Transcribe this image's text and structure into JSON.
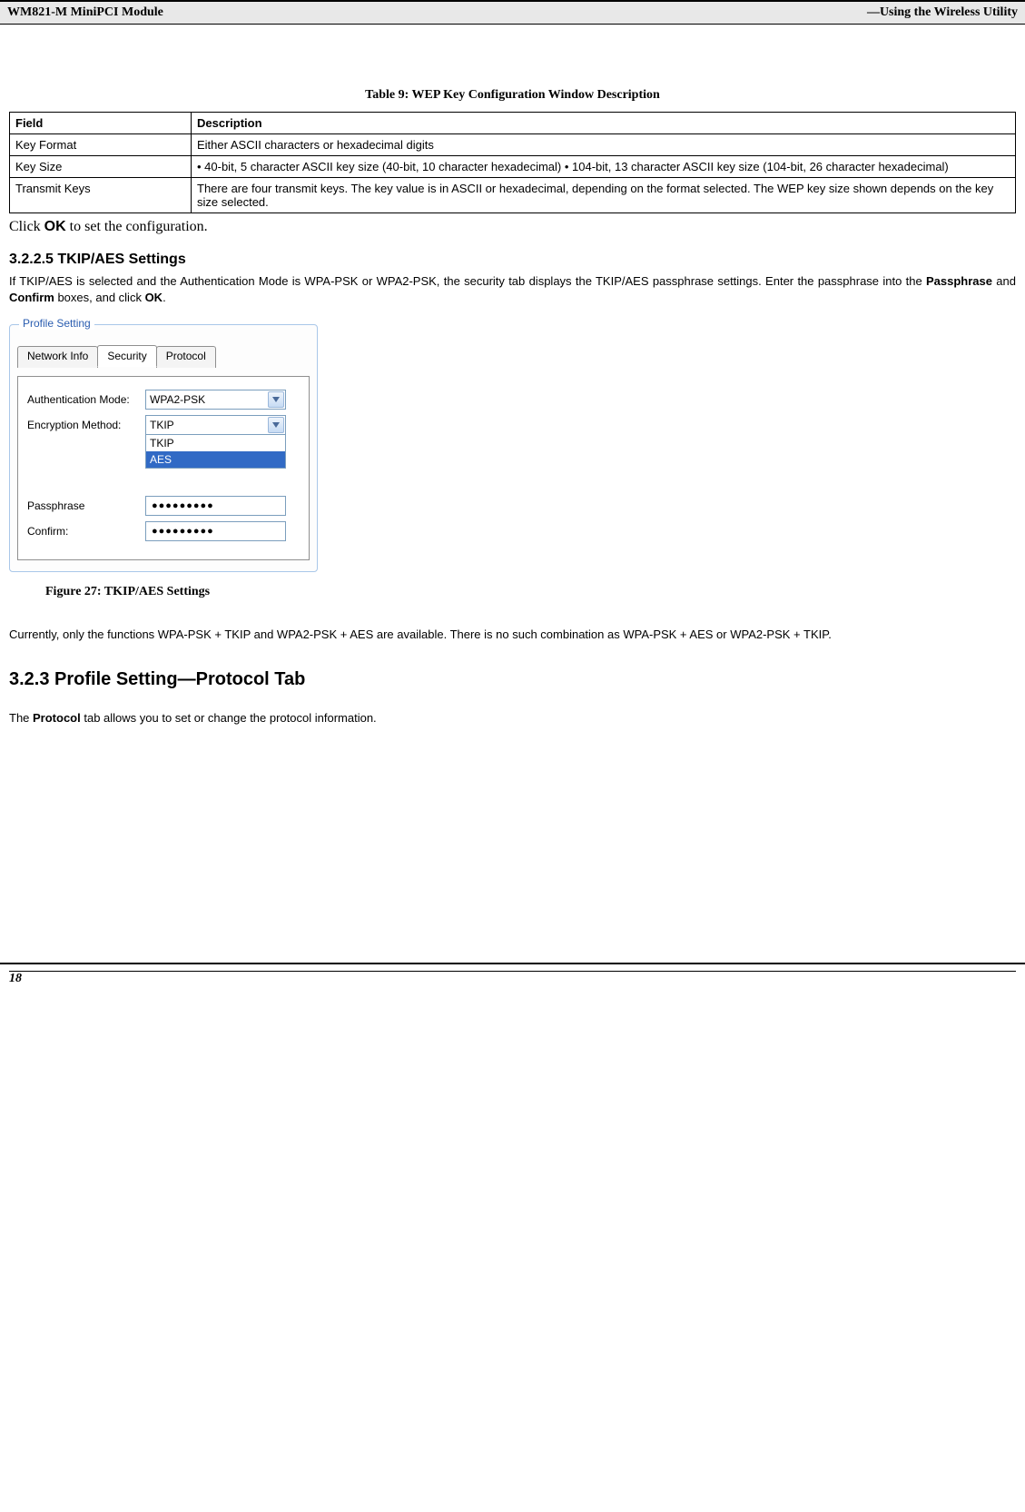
{
  "header": {
    "left": "WM821-M MiniPCI Module",
    "right": "—Using the Wireless Utility"
  },
  "table": {
    "caption": "Table 9: WEP Key Configuration Window Description",
    "headers": [
      "Field",
      "Description"
    ],
    "rows": [
      {
        "field": "Key Format",
        "desc": "Either ASCII characters or hexadecimal digits"
      },
      {
        "field": "Key Size",
        "desc": "• 40-bit, 5 character ASCII key size (40-bit, 10 character hexadecimal) • 104-bit, 13 character ASCII key size (104-bit, 26 character hexadecimal)"
      },
      {
        "field": "Transmit Keys",
        "desc": "There are four transmit keys. The key value is in ASCII or hexadecimal, depending on the format selected. The WEP key size shown depends on the key size selected."
      }
    ]
  },
  "after_table": {
    "pre": "Click ",
    "bold": "OK",
    "post": " to set the configuration."
  },
  "section_tkip": {
    "heading": "3.2.2.5 TKIP/AES Settings",
    "p1_pre": "If TKIP/AES is selected and the Authentication Mode is WPA-PSK or WPA2-PSK, the security tab displays the TKIP/AES passphrase settings. Enter the passphrase into the ",
    "p1_b1": "Passphrase",
    "p1_mid1": " and ",
    "p1_b2": "Confirm",
    "p1_mid2": " boxes, and click ",
    "p1_b3": "OK",
    "p1_end": "."
  },
  "dialog": {
    "group_title": "Profile Setting",
    "tabs": [
      "Network Info",
      "Security",
      "Protocol"
    ],
    "active_tab_index": 1,
    "auth_label": "Authentication Mode:",
    "auth_value": "WPA2-PSK",
    "enc_label": "Encryption Method:",
    "enc_value": "TKIP",
    "enc_options": [
      "TKIP",
      "AES"
    ],
    "enc_selected_index": 1,
    "pass_label": "Passphrase",
    "pass_value": "●●●●●●●●●",
    "confirm_label": "Confirm:",
    "confirm_value": "●●●●●●●●●"
  },
  "figure_caption": "Figure 27: TKIP/AES Settings",
  "currently_text": "Currently, only the functions WPA-PSK + TKIP and WPA2-PSK + AES are available. There is no such combination as WPA-PSK + AES or WPA2-PSK + TKIP.",
  "section_protocol": {
    "heading": "3.2.3 Profile Setting—Protocol Tab",
    "p_pre": "The ",
    "p_b": "Protocol",
    "p_post": " tab allows you to set or change the protocol information."
  },
  "footer": {
    "page": "18"
  }
}
